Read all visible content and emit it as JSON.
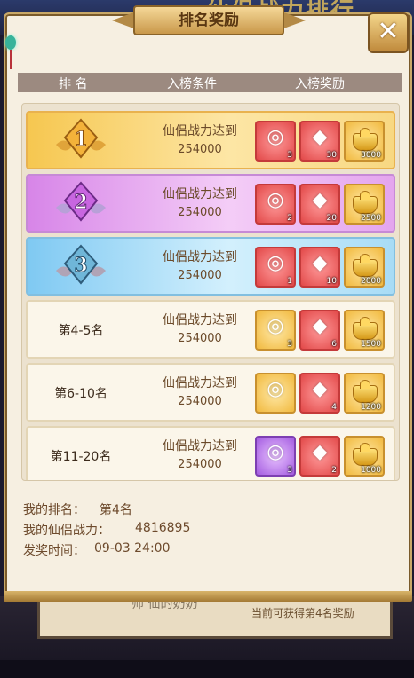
{
  "background": {
    "title_partial": "仙侣战力排行",
    "card_name_partial": "师 仙的奶奶",
    "card_note": "当前可获得第4名奖励"
  },
  "dialog": {
    "title": "排名奖励",
    "close_icon": "close-x-icon"
  },
  "table": {
    "headers": [
      "排 名",
      "入榜条件",
      "入榜奖励"
    ],
    "rows": [
      {
        "rank_label": "1",
        "condition": "仙侣战力达到",
        "threshold": "254000",
        "rewards": [
          {
            "icon": "ring-icon",
            "color": "red",
            "count": "3"
          },
          {
            "icon": "crystal-icon",
            "color": "red",
            "count": "30"
          },
          {
            "icon": "gold-ingot-icon",
            "color": "gold",
            "count": "3000"
          }
        ]
      },
      {
        "rank_label": "2",
        "condition": "仙侣战力达到",
        "threshold": "254000",
        "rewards": [
          {
            "icon": "ring-icon",
            "color": "red",
            "count": "2"
          },
          {
            "icon": "crystal-icon",
            "color": "red",
            "count": "20"
          },
          {
            "icon": "gold-ingot-icon",
            "color": "gold",
            "count": "2500"
          }
        ]
      },
      {
        "rank_label": "3",
        "condition": "仙侣战力达到",
        "threshold": "254000",
        "rewards": [
          {
            "icon": "ring-icon",
            "color": "red",
            "count": "1"
          },
          {
            "icon": "crystal-icon",
            "color": "red",
            "count": "10"
          },
          {
            "icon": "gold-ingot-icon",
            "color": "gold",
            "count": "2000"
          }
        ]
      },
      {
        "rank_label": "第4-5名",
        "condition": "仙侣战力达到",
        "threshold": "254000",
        "rewards": [
          {
            "icon": "ring-icon",
            "color": "gold",
            "count": "3"
          },
          {
            "icon": "crystal-icon",
            "color": "red",
            "count": "6"
          },
          {
            "icon": "gold-ingot-icon",
            "color": "gold",
            "count": "1500"
          }
        ]
      },
      {
        "rank_label": "第6-10名",
        "condition": "仙侣战力达到",
        "threshold": "254000",
        "rewards": [
          {
            "icon": "ring-icon",
            "color": "gold",
            "count": ""
          },
          {
            "icon": "crystal-icon",
            "color": "red",
            "count": "4"
          },
          {
            "icon": "gold-ingot-icon",
            "color": "gold",
            "count": "1200"
          }
        ]
      },
      {
        "rank_label": "第11-20名",
        "condition": "仙侣战力达到",
        "threshold": "254000",
        "rewards": [
          {
            "icon": "ring-icon",
            "color": "purple",
            "count": "3"
          },
          {
            "icon": "crystal-icon",
            "color": "red",
            "count": "2"
          },
          {
            "icon": "gold-ingot-icon",
            "color": "gold",
            "count": "1000"
          }
        ]
      }
    ]
  },
  "info": {
    "my_rank_label": "我的排名：",
    "my_rank_value": "第4名",
    "my_power_label": "我的仙侣战力：",
    "my_power_value": "4816895",
    "award_time_label": "发奖时间：",
    "award_time_value": "09-03 24:00"
  }
}
